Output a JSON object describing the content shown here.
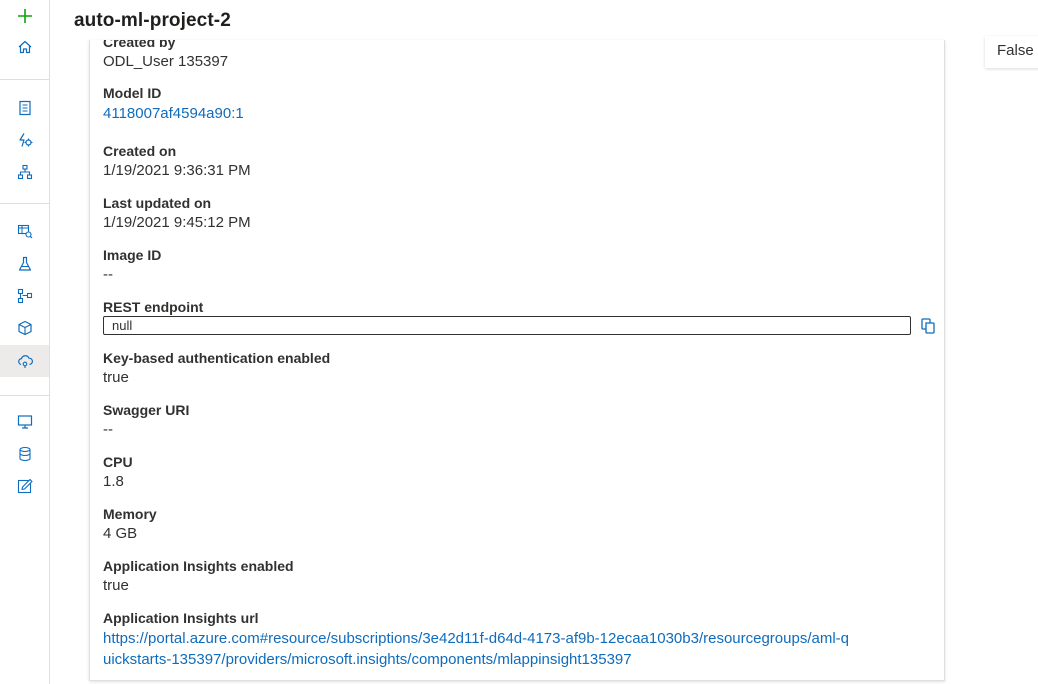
{
  "header": {
    "title": "auto-ml-project-2"
  },
  "right_panel": {
    "value": "False"
  },
  "details": {
    "created_by": {
      "label": "Created by",
      "value": "ODL_User 135397"
    },
    "model_id": {
      "label": "Model ID",
      "value": "4118007af4594a90:1"
    },
    "created_on": {
      "label": "Created on",
      "value": "1/19/2021 9:36:31 PM"
    },
    "last_updated_on": {
      "label": "Last updated on",
      "value": "1/19/2021 9:45:12 PM"
    },
    "image_id": {
      "label": "Image ID",
      "value": "--"
    },
    "rest_endpoint": {
      "label": "REST endpoint",
      "value": "null"
    },
    "key_auth": {
      "label": "Key-based authentication enabled",
      "value": "true"
    },
    "swagger_uri": {
      "label": "Swagger URI",
      "value": "--"
    },
    "cpu": {
      "label": "CPU",
      "value": "1.8"
    },
    "memory": {
      "label": "Memory",
      "value": "4 GB"
    },
    "app_insights_enabled": {
      "label": "Application Insights enabled",
      "value": "true"
    },
    "app_insights_url": {
      "label": "Application Insights url",
      "line1": "https://portal.azure.com#resource/subscriptions/3e42d11f-d64d-4173-af9b-12ecaa1030b3/resourcegroups/aml-q",
      "line2": "uickstarts-135397/providers/microsoft.insights/components/mlappinsight135397"
    }
  },
  "nav_icons": [
    "plus-icon",
    "home-icon",
    "notebook-icon",
    "automl-icon",
    "designer-icon",
    "datasets-icon",
    "experiments-icon",
    "pipelines-icon",
    "models-icon",
    "endpoints-icon",
    "compute-icon",
    "datastores-icon",
    "labeling-icon"
  ],
  "colors": {
    "accent_link": "#0f6cbd",
    "add_green": "#13a10e",
    "nav_icon": "#0f6cbd",
    "active_bg": "#edebe9"
  }
}
